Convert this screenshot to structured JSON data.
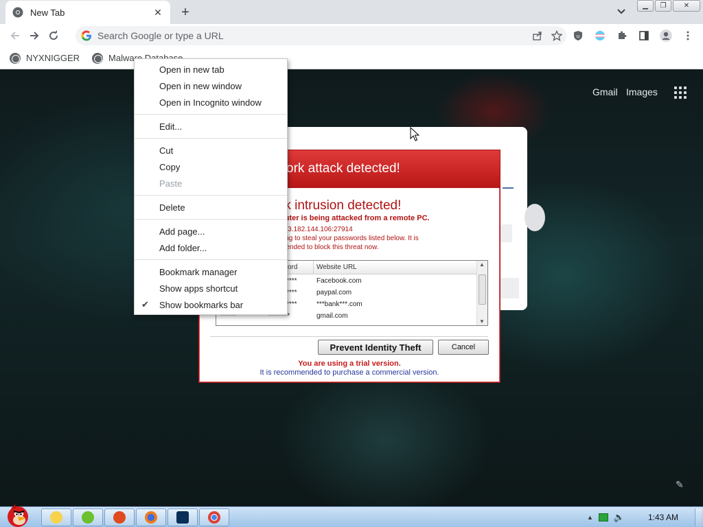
{
  "browser": {
    "tab": {
      "title": "New Tab"
    },
    "omnibox": {
      "placeholder": "Search Google or type a URL"
    },
    "bookmarks": [
      {
        "label": "NYXNIGGER"
      },
      {
        "label": "Malware Database"
      }
    ]
  },
  "newtab": {
    "gmail": "Gmail",
    "images": "Images"
  },
  "context_menu": {
    "items": [
      {
        "label": "Open in new tab",
        "enabled": true
      },
      {
        "label": "Open in new window",
        "enabled": true
      },
      {
        "label": "Open in Incognito window",
        "enabled": true
      },
      {
        "label": "Edit...",
        "enabled": true
      },
      {
        "label": "Cut",
        "enabled": true
      },
      {
        "label": "Copy",
        "enabled": true
      },
      {
        "label": "Paste",
        "enabled": false
      },
      {
        "label": "Delete",
        "enabled": true
      },
      {
        "label": "Add page...",
        "enabled": true
      },
      {
        "label": "Add folder...",
        "enabled": true
      },
      {
        "label": "Bookmark manager",
        "enabled": true
      },
      {
        "label": "Show apps shortcut",
        "enabled": true
      },
      {
        "label": "Show bookmarks bar",
        "enabled": true,
        "checked": true
      }
    ]
  },
  "alert": {
    "header": "twork attack detected!",
    "title": "rk intrusion detected!",
    "subtitle": "puter is being attacked from a remote PC.",
    "ip": "183.182.144.106:27914",
    "message_line1": "ying to steal your passwords listed below. It is",
    "message_line2": "mended to block this threat now.",
    "columns": [
      "ord",
      "Website URL"
    ],
    "rows": [
      {
        "user": "",
        "password": "****",
        "url": "Facebook.com"
      },
      {
        "user": "",
        "password": "****",
        "url": "paypal.com"
      },
      {
        "user": "",
        "password": "****",
        "url": "***bank***.com"
      },
      {
        "user": "******",
        "password": "********",
        "url": "gmail.com"
      }
    ],
    "prevent_button": "Prevent Identity Theft",
    "cancel_button": "Cancel",
    "trial_line1": "You are using a trial version.",
    "trial_line2": "It is recommended to purchase a commercial version."
  },
  "taskbar": {
    "clock": "1:43 AM"
  },
  "colors": {
    "alert_red": "#b01212",
    "taskbar_blue": "#9cc3e8"
  }
}
